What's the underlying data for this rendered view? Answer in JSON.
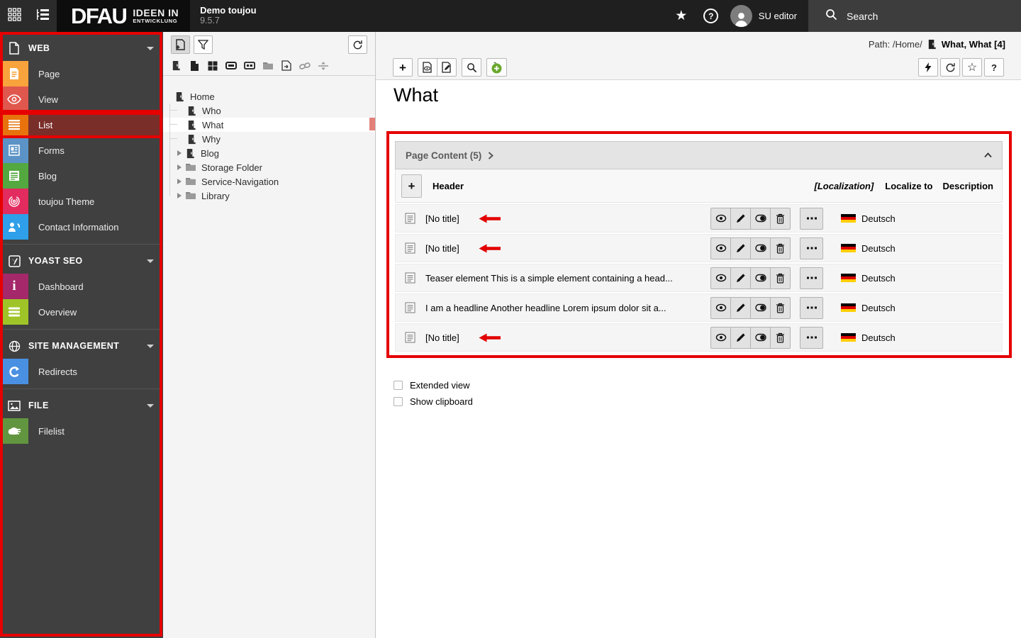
{
  "topbar": {
    "logo_main": "DFAU",
    "logo_tagline_line1": "IDEEN IN",
    "logo_tagline_line2": "ENTWICKLUNG",
    "site_name": "Demo toujou",
    "version": "9.5.7",
    "username": "SU editor",
    "search_label": "Search"
  },
  "colors": {
    "annotation_red": "#e60000",
    "selected_module_bg": "#7a2e2a",
    "topbar_bg": "#1f1f1f",
    "sidebar_bg": "#404040",
    "flag_black": "#000000",
    "flag_red": "#dd0000",
    "flag_gold": "#ffce00"
  },
  "sidebar": {
    "sections": [
      {
        "label": "WEB",
        "items": [
          {
            "label": "Page",
            "color": "#f8a33c"
          },
          {
            "label": "View",
            "color": "#e0574e"
          },
          {
            "label": "List",
            "color": "#e8720c",
            "selected": true
          },
          {
            "label": "Forms",
            "color": "#5b93c6"
          },
          {
            "label": "Blog",
            "color": "#53a93f"
          },
          {
            "label": "toujou Theme",
            "color": "#e22b5e"
          },
          {
            "label": "Contact Information",
            "color": "#2e9fe8"
          }
        ]
      },
      {
        "label": "YOAST SEO",
        "items": [
          {
            "label": "Dashboard",
            "color": "#a4286a"
          },
          {
            "label": "Overview",
            "color": "#9fc427"
          }
        ]
      },
      {
        "label": "SITE MANAGEMENT",
        "items": [
          {
            "label": "Redirects",
            "color": "#4a90e2"
          }
        ]
      },
      {
        "label": "FILE",
        "items": [
          {
            "label": "Filelist",
            "color": "#62953f"
          }
        ]
      }
    ]
  },
  "pagetree": {
    "nodes": [
      {
        "label": "Home"
      },
      {
        "label": "Who"
      },
      {
        "label": "What",
        "selected": true
      },
      {
        "label": "Why"
      },
      {
        "label": "Blog"
      },
      {
        "label": "Storage Folder"
      },
      {
        "label": "Service-Navigation"
      },
      {
        "label": "Library"
      }
    ]
  },
  "docheader": {
    "path_prefix": "Path: /Home/",
    "page_reference": "What, What [4]"
  },
  "content": {
    "page_title": "What",
    "panel": {
      "title": "Page Content (5)",
      "column_header": "Header",
      "column_localization": "[Localization]",
      "column_localize_to": "Localize to",
      "column_description": "Description",
      "rows": [
        {
          "title": "[No title]",
          "language": "Deutsch"
        },
        {
          "title": "[No title]",
          "language": "Deutsch"
        },
        {
          "title": "Teaser element This is a simple element containing a head...",
          "language": "Deutsch"
        },
        {
          "title": "I am a headline Another headline Lorem ipsum dolor sit a...",
          "language": "Deutsch"
        },
        {
          "title": "[No title]",
          "language": "Deutsch"
        }
      ]
    },
    "options": [
      {
        "label": "Extended view",
        "checked": false
      },
      {
        "label": "Show clipboard",
        "checked": false
      }
    ]
  }
}
